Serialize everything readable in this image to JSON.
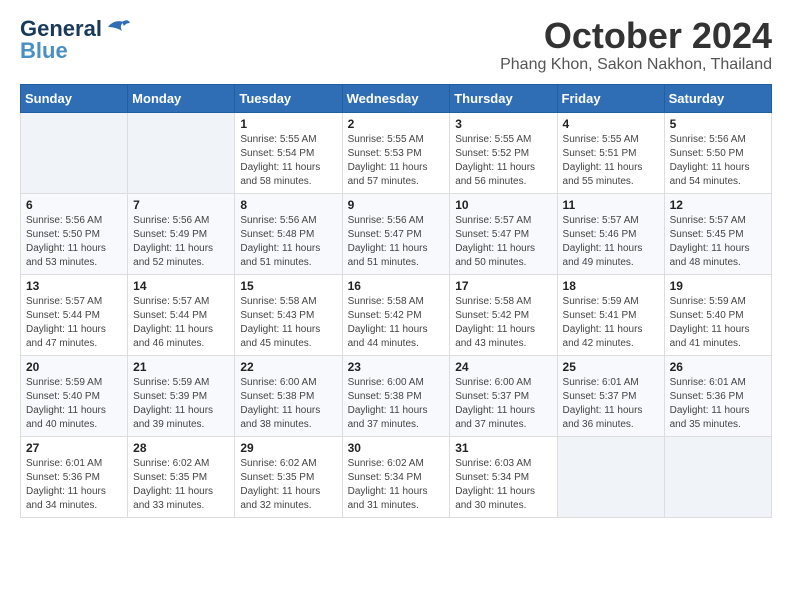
{
  "logo": {
    "general": "General",
    "blue": "Blue"
  },
  "title": "October 2024",
  "location": "Phang Khon, Sakon Nakhon, Thailand",
  "headers": [
    "Sunday",
    "Monday",
    "Tuesday",
    "Wednesday",
    "Thursday",
    "Friday",
    "Saturday"
  ],
  "weeks": [
    [
      {
        "day": "",
        "info": ""
      },
      {
        "day": "",
        "info": ""
      },
      {
        "day": "1",
        "info": "Sunrise: 5:55 AM\nSunset: 5:54 PM\nDaylight: 11 hours and 58 minutes."
      },
      {
        "day": "2",
        "info": "Sunrise: 5:55 AM\nSunset: 5:53 PM\nDaylight: 11 hours and 57 minutes."
      },
      {
        "day": "3",
        "info": "Sunrise: 5:55 AM\nSunset: 5:52 PM\nDaylight: 11 hours and 56 minutes."
      },
      {
        "day": "4",
        "info": "Sunrise: 5:55 AM\nSunset: 5:51 PM\nDaylight: 11 hours and 55 minutes."
      },
      {
        "day": "5",
        "info": "Sunrise: 5:56 AM\nSunset: 5:50 PM\nDaylight: 11 hours and 54 minutes."
      }
    ],
    [
      {
        "day": "6",
        "info": "Sunrise: 5:56 AM\nSunset: 5:50 PM\nDaylight: 11 hours and 53 minutes."
      },
      {
        "day": "7",
        "info": "Sunrise: 5:56 AM\nSunset: 5:49 PM\nDaylight: 11 hours and 52 minutes."
      },
      {
        "day": "8",
        "info": "Sunrise: 5:56 AM\nSunset: 5:48 PM\nDaylight: 11 hours and 51 minutes."
      },
      {
        "day": "9",
        "info": "Sunrise: 5:56 AM\nSunset: 5:47 PM\nDaylight: 11 hours and 51 minutes."
      },
      {
        "day": "10",
        "info": "Sunrise: 5:57 AM\nSunset: 5:47 PM\nDaylight: 11 hours and 50 minutes."
      },
      {
        "day": "11",
        "info": "Sunrise: 5:57 AM\nSunset: 5:46 PM\nDaylight: 11 hours and 49 minutes."
      },
      {
        "day": "12",
        "info": "Sunrise: 5:57 AM\nSunset: 5:45 PM\nDaylight: 11 hours and 48 minutes."
      }
    ],
    [
      {
        "day": "13",
        "info": "Sunrise: 5:57 AM\nSunset: 5:44 PM\nDaylight: 11 hours and 47 minutes."
      },
      {
        "day": "14",
        "info": "Sunrise: 5:57 AM\nSunset: 5:44 PM\nDaylight: 11 hours and 46 minutes."
      },
      {
        "day": "15",
        "info": "Sunrise: 5:58 AM\nSunset: 5:43 PM\nDaylight: 11 hours and 45 minutes."
      },
      {
        "day": "16",
        "info": "Sunrise: 5:58 AM\nSunset: 5:42 PM\nDaylight: 11 hours and 44 minutes."
      },
      {
        "day": "17",
        "info": "Sunrise: 5:58 AM\nSunset: 5:42 PM\nDaylight: 11 hours and 43 minutes."
      },
      {
        "day": "18",
        "info": "Sunrise: 5:59 AM\nSunset: 5:41 PM\nDaylight: 11 hours and 42 minutes."
      },
      {
        "day": "19",
        "info": "Sunrise: 5:59 AM\nSunset: 5:40 PM\nDaylight: 11 hours and 41 minutes."
      }
    ],
    [
      {
        "day": "20",
        "info": "Sunrise: 5:59 AM\nSunset: 5:40 PM\nDaylight: 11 hours and 40 minutes."
      },
      {
        "day": "21",
        "info": "Sunrise: 5:59 AM\nSunset: 5:39 PM\nDaylight: 11 hours and 39 minutes."
      },
      {
        "day": "22",
        "info": "Sunrise: 6:00 AM\nSunset: 5:38 PM\nDaylight: 11 hours and 38 minutes."
      },
      {
        "day": "23",
        "info": "Sunrise: 6:00 AM\nSunset: 5:38 PM\nDaylight: 11 hours and 37 minutes."
      },
      {
        "day": "24",
        "info": "Sunrise: 6:00 AM\nSunset: 5:37 PM\nDaylight: 11 hours and 37 minutes."
      },
      {
        "day": "25",
        "info": "Sunrise: 6:01 AM\nSunset: 5:37 PM\nDaylight: 11 hours and 36 minutes."
      },
      {
        "day": "26",
        "info": "Sunrise: 6:01 AM\nSunset: 5:36 PM\nDaylight: 11 hours and 35 minutes."
      }
    ],
    [
      {
        "day": "27",
        "info": "Sunrise: 6:01 AM\nSunset: 5:36 PM\nDaylight: 11 hours and 34 minutes."
      },
      {
        "day": "28",
        "info": "Sunrise: 6:02 AM\nSunset: 5:35 PM\nDaylight: 11 hours and 33 minutes."
      },
      {
        "day": "29",
        "info": "Sunrise: 6:02 AM\nSunset: 5:35 PM\nDaylight: 11 hours and 32 minutes."
      },
      {
        "day": "30",
        "info": "Sunrise: 6:02 AM\nSunset: 5:34 PM\nDaylight: 11 hours and 31 minutes."
      },
      {
        "day": "31",
        "info": "Sunrise: 6:03 AM\nSunset: 5:34 PM\nDaylight: 11 hours and 30 minutes."
      },
      {
        "day": "",
        "info": ""
      },
      {
        "day": "",
        "info": ""
      }
    ]
  ]
}
